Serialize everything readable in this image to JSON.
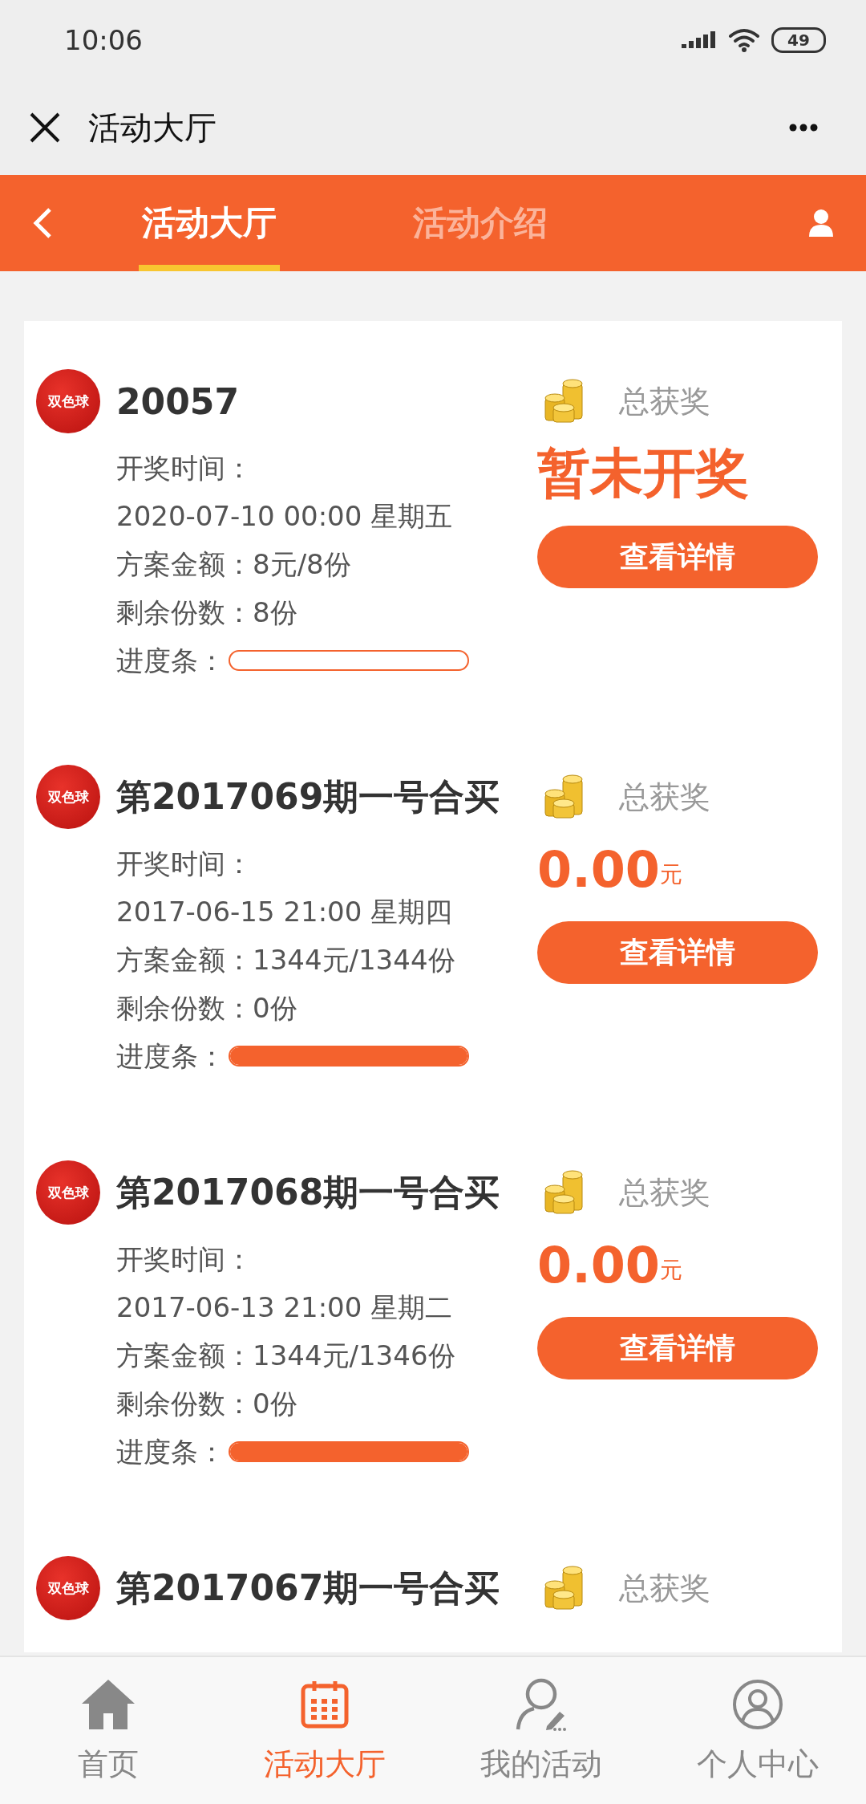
{
  "status_bar": {
    "time": "10:06",
    "battery": "49"
  },
  "title_bar": {
    "title": "活动大厅"
  },
  "tabs": [
    {
      "label": "活动大厅",
      "selected": true
    },
    {
      "label": "活动介绍",
      "selected": false
    }
  ],
  "cards": [
    {
      "logo": "双色球",
      "title": "20057",
      "draw_time_label": "开奖时间：",
      "draw_time": "2020-07-10 00:00 星期五",
      "amount": "方案金额：8元/8份",
      "remaining": "剩余份数：8份",
      "progress_label": "进度条：",
      "progress": {
        "level": 0
      },
      "prize_label": "总获奖",
      "prize": {
        "kind": "pending",
        "text": "暂未开奖"
      },
      "button": "查看详情"
    },
    {
      "logo": "双色球",
      "title": "第2017069期一号合买",
      "draw_time_label": "开奖时间：",
      "draw_time": "2017-06-15 21:00 星期四",
      "amount": "方案金额：1344元/1344份",
      "remaining": "剩余份数：0份",
      "progress_label": "进度条：",
      "progress": {
        "level": 1
      },
      "prize_label": "总获奖",
      "prize": {
        "kind": "amount",
        "value": "0.00",
        "unit": "元"
      },
      "button": "查看详情"
    },
    {
      "logo": "双色球",
      "title": "第2017068期一号合买",
      "draw_time_label": "开奖时间：",
      "draw_time": "2017-06-13 21:00 星期二",
      "amount": "方案金额：1344元/1346份",
      "remaining": "剩余份数：0份",
      "progress_label": "进度条：",
      "progress": {
        "level": 1
      },
      "prize_label": "总获奖",
      "prize": {
        "kind": "amount",
        "value": "0.00",
        "unit": "元"
      },
      "button": "查看详情"
    },
    {
      "logo": "双色球",
      "title": "第2017067期一号合买",
      "prize_label": "总获奖"
    }
  ],
  "bottom_nav": [
    {
      "label": "首页",
      "selected": false
    },
    {
      "label": "活动大厅",
      "selected": true
    },
    {
      "label": "我的活动",
      "selected": false
    },
    {
      "label": "个人中心",
      "selected": false
    }
  ]
}
